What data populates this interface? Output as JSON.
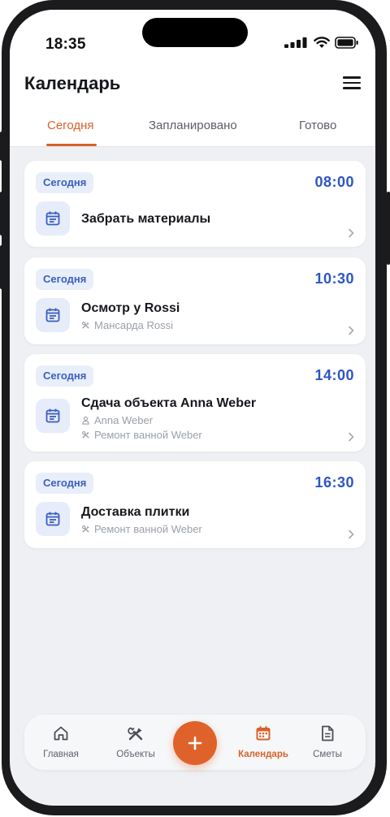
{
  "status_bar": {
    "time": "18:35"
  },
  "header": {
    "title": "Календарь"
  },
  "tabs": [
    {
      "label": "Сегодня",
      "active": true
    },
    {
      "label": "Запланировано",
      "active": false
    },
    {
      "label": "Готово",
      "active": false
    }
  ],
  "events": [
    {
      "badge": "Сегодня",
      "time": "08:00",
      "title": "Забрать материалы",
      "person": "",
      "project": ""
    },
    {
      "badge": "Сегодня",
      "time": "10:30",
      "title": "Осмотр у Rossi",
      "person": "",
      "project": "Мансарда Rossi"
    },
    {
      "badge": "Сегодня",
      "time": "14:00",
      "title": "Сдача объекта Anna Weber",
      "person": "Anna Weber",
      "project": "Ремонт ванной Weber"
    },
    {
      "badge": "Сегодня",
      "time": "16:30",
      "title": "Доставка плитки",
      "person": "",
      "project": "Ремонт ванной Weber"
    }
  ],
  "bottom_nav": [
    {
      "label": "Главная",
      "icon": "home-icon",
      "active": false
    },
    {
      "label": "Объекты",
      "icon": "tools-icon",
      "active": false
    },
    {
      "label": "Календарь",
      "icon": "calendar-icon",
      "active": true
    },
    {
      "label": "Сметы",
      "icon": "document-icon",
      "active": false
    }
  ],
  "fab": {
    "icon": "plus-icon"
  },
  "colors": {
    "accent": "#e0622b",
    "time_blue": "#2d56c4",
    "badge_bg": "#e9eefb",
    "background": "#eef0f3"
  }
}
